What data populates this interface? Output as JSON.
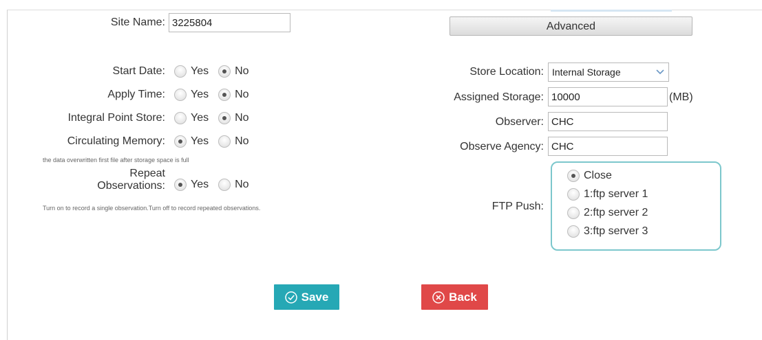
{
  "site_name": {
    "label": "Site Name:",
    "value": "3225804"
  },
  "advanced_button": {
    "label": "Advanced"
  },
  "left_form": {
    "start_date": {
      "label": "Start Date:",
      "yes": "Yes",
      "no": "No",
      "selected": "No"
    },
    "apply_time": {
      "label": "Apply Time:",
      "yes": "Yes",
      "no": "No",
      "selected": "No"
    },
    "integral_point_store": {
      "label": "Integral Point Store:",
      "yes": "Yes",
      "no": "No",
      "selected": "No"
    },
    "circulating_memory": {
      "label": "Circulating Memory:",
      "yes": "Yes",
      "no": "No",
      "selected": "Yes",
      "hint": "the data overwritten first file after storage space is full"
    },
    "repeat_observations": {
      "label_line1": "Repeat",
      "label_line2": "Observations:",
      "yes": "Yes",
      "no": "No",
      "selected": "Yes",
      "hint": "Turn on to record a single observation.Turn off to record repeated observations."
    }
  },
  "right_form": {
    "store_location": {
      "label": "Store Location:",
      "value": "Internal Storage"
    },
    "assigned_storage": {
      "label": "Assigned Storage:",
      "value": "10000",
      "unit": "(MB)"
    },
    "observer": {
      "label": "Observer:",
      "value": "CHC"
    },
    "observe_agency": {
      "label": "Observe Agency:",
      "value": "CHC"
    },
    "ftp_push": {
      "label": "FTP Push:",
      "options": [
        "Close",
        "1:ftp server 1",
        "2:ftp server 2",
        "3:ftp server 3"
      ],
      "selected": "Close"
    }
  },
  "actions": {
    "save": {
      "label": "Save",
      "icon": "check-circle-icon",
      "color": "#26a8b5"
    },
    "back": {
      "label": "Back",
      "icon": "x-circle-icon",
      "color": "#e04848"
    }
  }
}
